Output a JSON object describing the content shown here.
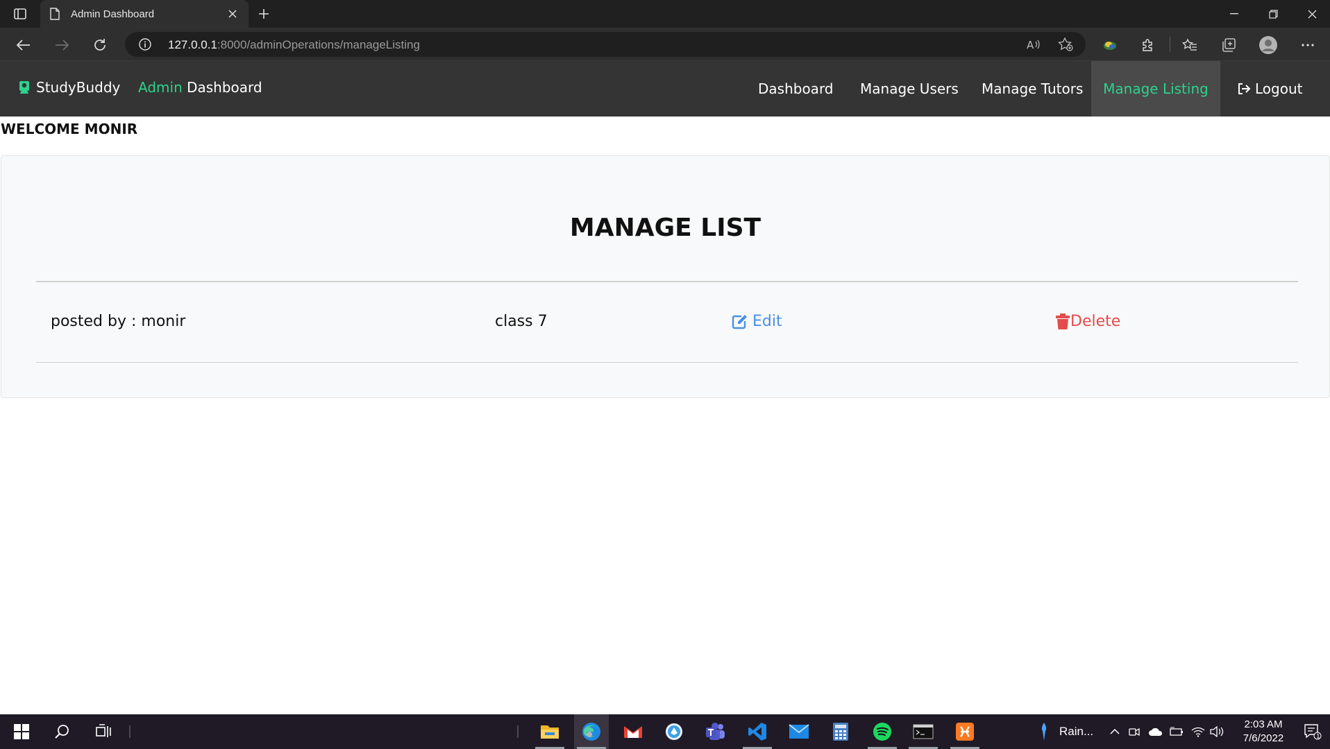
{
  "browser": {
    "tab_title": "Admin Dashboard",
    "url_host": "127.0.0.1",
    "url_rest": ":8000/adminOperations/manageListing"
  },
  "site": {
    "brand": "StudyBuddy",
    "subtitle_accent": "Admin",
    "subtitle_rest": " Dashboard",
    "nav": {
      "dashboard": "Dashboard",
      "manage_users": "Manage Users",
      "manage_tutors": "Manage Tutors",
      "manage_listing": "Manage Listing",
      "logout": "Logout"
    },
    "accent_color": "#2dd28e"
  },
  "welcome": "WELCOME MONIR",
  "main": {
    "title": "MANAGE LIST",
    "listing": {
      "posted_by": "posted by : monir",
      "class": "class 7",
      "edit_label": "Edit",
      "delete_label": "Delete"
    }
  },
  "taskbar": {
    "weather": "Rain...",
    "time": "2:03 AM",
    "date": "7/6/2022",
    "notification_count": "1"
  }
}
